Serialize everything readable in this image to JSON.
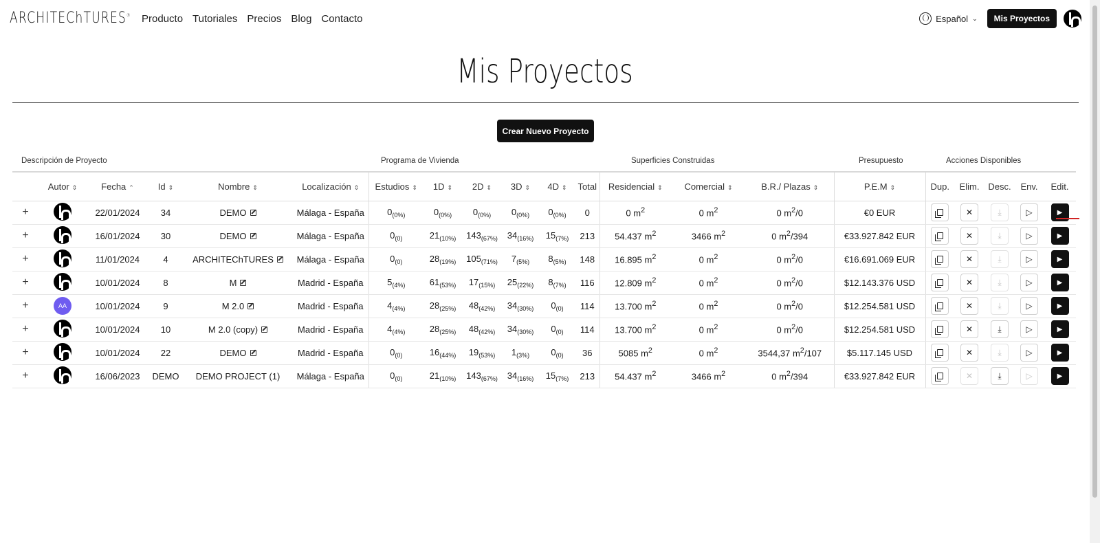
{
  "header": {
    "logo": "ARCHITEChTURES",
    "logo_mark": "®",
    "nav": [
      "Producto",
      "Tutoriales",
      "Precios",
      "Blog",
      "Contacto"
    ],
    "language": "Español",
    "my_projects_button": "Mis Proyectos"
  },
  "page": {
    "title": "Mis Proyectos",
    "create_button": "Crear Nuevo Proyecto"
  },
  "table": {
    "groups": [
      "Descripción de Proyecto",
      "Programa de Vivienda",
      "Superficies Construidas",
      "Presupuesto",
      "Acciones Disponibles"
    ],
    "columns": [
      "Autor",
      "Fecha",
      "Id",
      "Nombre",
      "Localización",
      "Estudios",
      "1D",
      "2D",
      "3D",
      "4D",
      "Total",
      "Residencial",
      "Comercial",
      "B.R./ Plazas",
      "P.E.M",
      "Dup.",
      "Elim.",
      "Desc.",
      "Env.",
      "Edit."
    ],
    "rows": [
      {
        "author": "h",
        "fecha": "22/01/2024",
        "id": "34",
        "nombre": "DEMO",
        "loc": "Málaga - España",
        "est": "0",
        "est_p": "(0%)",
        "d1": "0",
        "d1_p": "(0%)",
        "d2": "0",
        "d2_p": "(0%)",
        "d3": "0",
        "d3_p": "(0%)",
        "d4": "0",
        "d4_p": "(0%)",
        "total": "0",
        "res": "0 m",
        "com": "0 m",
        "br": "0 m",
        "br_suffix": "/0",
        "pem": "€0 EUR",
        "elim_enabled": true,
        "desc_enabled": false,
        "env_enabled": true
      },
      {
        "author": "h",
        "fecha": "16/01/2024",
        "id": "30",
        "nombre": "DEMO",
        "loc": "Málaga - España",
        "est": "0",
        "est_p": "(0)",
        "d1": "21",
        "d1_p": "(10%)",
        "d2": "143",
        "d2_p": "(67%)",
        "d3": "34",
        "d3_p": "(16%)",
        "d4": "15",
        "d4_p": "(7%)",
        "total": "213",
        "res": "54.437 m",
        "com": "3466 m",
        "br": "0 m",
        "br_suffix": "/394",
        "pem": "€33.927.842 EUR",
        "elim_enabled": true,
        "desc_enabled": false,
        "env_enabled": true
      },
      {
        "author": "h",
        "fecha": "11/01/2024",
        "id": "4",
        "nombre": "ARCHITEChTURES",
        "loc": "Málaga - España",
        "est": "0",
        "est_p": "(0)",
        "d1": "28",
        "d1_p": "(19%)",
        "d2": "105",
        "d2_p": "(71%)",
        "d3": "7",
        "d3_p": "(5%)",
        "d4": "8",
        "d4_p": "(5%)",
        "total": "148",
        "res": "16.895 m",
        "com": "0 m",
        "br": "0 m",
        "br_suffix": "/0",
        "pem": "€16.691.069 EUR",
        "elim_enabled": true,
        "desc_enabled": false,
        "env_enabled": true
      },
      {
        "author": "h",
        "fecha": "10/01/2024",
        "id": "8",
        "nombre": "M",
        "loc": "Madrid - España",
        "est": "5",
        "est_p": "(4%)",
        "d1": "61",
        "d1_p": "(53%)",
        "d2": "17",
        "d2_p": "(15%)",
        "d3": "25",
        "d3_p": "(22%)",
        "d4": "8",
        "d4_p": "(7%)",
        "total": "116",
        "res": "12.809 m",
        "com": "0 m",
        "br": "0 m",
        "br_suffix": "/0",
        "pem": "$12.143.376 USD",
        "elim_enabled": true,
        "desc_enabled": false,
        "env_enabled": true
      },
      {
        "author": "AA",
        "fecha": "10/01/2024",
        "id": "9",
        "nombre": "M 2.0",
        "loc": "Madrid - España",
        "est": "4",
        "est_p": "(4%)",
        "d1": "28",
        "d1_p": "(25%)",
        "d2": "48",
        "d2_p": "(42%)",
        "d3": "34",
        "d3_p": "(30%)",
        "d4": "0",
        "d4_p": "(0)",
        "total": "114",
        "res": "13.700 m",
        "com": "0 m",
        "br": "0 m",
        "br_suffix": "/0",
        "pem": "$12.254.581 USD",
        "elim_enabled": true,
        "desc_enabled": false,
        "env_enabled": true
      },
      {
        "author": "h",
        "fecha": "10/01/2024",
        "id": "10",
        "nombre": "M 2.0 (copy)",
        "loc": "Madrid - España",
        "est": "4",
        "est_p": "(4%)",
        "d1": "28",
        "d1_p": "(25%)",
        "d2": "48",
        "d2_p": "(42%)",
        "d3": "34",
        "d3_p": "(30%)",
        "d4": "0",
        "d4_p": "(0)",
        "total": "114",
        "res": "13.700 m",
        "com": "0 m",
        "br": "0 m",
        "br_suffix": "/0",
        "pem": "$12.254.581 USD",
        "elim_enabled": true,
        "desc_enabled": true,
        "env_enabled": true
      },
      {
        "author": "h",
        "fecha": "10/01/2024",
        "id": "22",
        "nombre": "DEMO",
        "loc": "Madrid - España",
        "est": "0",
        "est_p": "(0)",
        "d1": "16",
        "d1_p": "(44%)",
        "d2": "19",
        "d2_p": "(53%)",
        "d3": "1",
        "d3_p": "(3%)",
        "d4": "0",
        "d4_p": "(0)",
        "total": "36",
        "res": "5085 m",
        "com": "0 m",
        "br": "3544,37 m",
        "br_suffix": "/107",
        "pem": "$5.117.145 USD",
        "elim_enabled": true,
        "desc_enabled": false,
        "env_enabled": true
      },
      {
        "author": "h",
        "fecha": "16/06/2023",
        "id": "DEMO",
        "nombre": "DEMO PROJECT (1)",
        "loc": "Málaga - España",
        "est": "0",
        "est_p": "(0)",
        "d1": "21",
        "d1_p": "(10%)",
        "d2": "143",
        "d2_p": "(67%)",
        "d3": "34",
        "d3_p": "(16%)",
        "d4": "15",
        "d4_p": "(7%)",
        "total": "213",
        "res": "54.437 m",
        "com": "3466 m",
        "br": "0 m",
        "br_suffix": "/394",
        "pem": "€33.927.842 EUR",
        "elim_enabled": false,
        "desc_enabled": true,
        "env_enabled": false
      }
    ]
  },
  "icons": {
    "expand": "plus-icon",
    "duplicate": "copy-icon",
    "delete": "close-icon",
    "download": "download-icon",
    "send": "send-icon",
    "edit": "play-icon",
    "rename": "edit-icon",
    "language": "globe-icon"
  },
  "colors": {
    "primary_dark": "#111111",
    "avatar_aa": "#6f5cf0",
    "highlight": "#d12424"
  }
}
